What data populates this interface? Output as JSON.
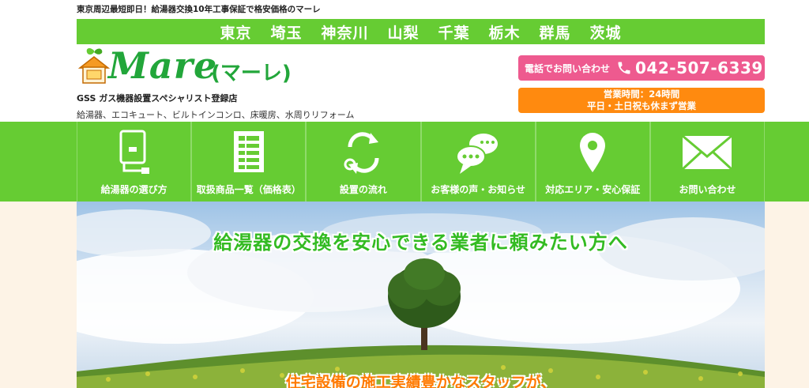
{
  "header": {
    "tagline": "東京周辺最短即日！給湯器交換10年工事保証で格安価格のマーレ",
    "areas": [
      "東京",
      "埼玉",
      "神奈川",
      "山梨",
      "千葉",
      "栃木",
      "群馬",
      "茨城"
    ],
    "logo_text": "Mare",
    "logo_kana": "(マーレ)",
    "gss_text": "GSS ガス機器設置スペシャリスト登録店",
    "services_text": "給湯器、エコキュート、ビルトインコンロ、床暖房、水周りリフォーム"
  },
  "contact": {
    "phone_label": "電話でお問い合わせ",
    "phone_icon": "phone-icon",
    "phone_number": "042-507-6339",
    "hours_line1": "営業時間：24時間",
    "hours_line2": "平日・土日祝も休まず営業"
  },
  "menu": [
    {
      "label": "給湯器の選び方",
      "icon": "water-heater-icon"
    },
    {
      "label": "取扱商品一覧（価格表）",
      "icon": "price-list-icon"
    },
    {
      "label": "設置の流れ",
      "icon": "cycle-arrows-icon"
    },
    {
      "label": "お客様の声・お知らせ",
      "icon": "speech-bubbles-icon"
    },
    {
      "label": "対応エリア・安心保証",
      "icon": "map-pin-icon"
    },
    {
      "label": "お問い合わせ",
      "icon": "envelope-icon"
    }
  ],
  "hero": {
    "headline": "給湯器の交換を安心できる業者に頼みたい方へ",
    "subline": "住宅設備の施工実績豊かなスタッフが、"
  },
  "colors": {
    "brand_green": "#66cc33",
    "logo_green": "#22a63a",
    "phone_pink": "#ee5a8f",
    "hours_orange": "#ff8a0f"
  }
}
